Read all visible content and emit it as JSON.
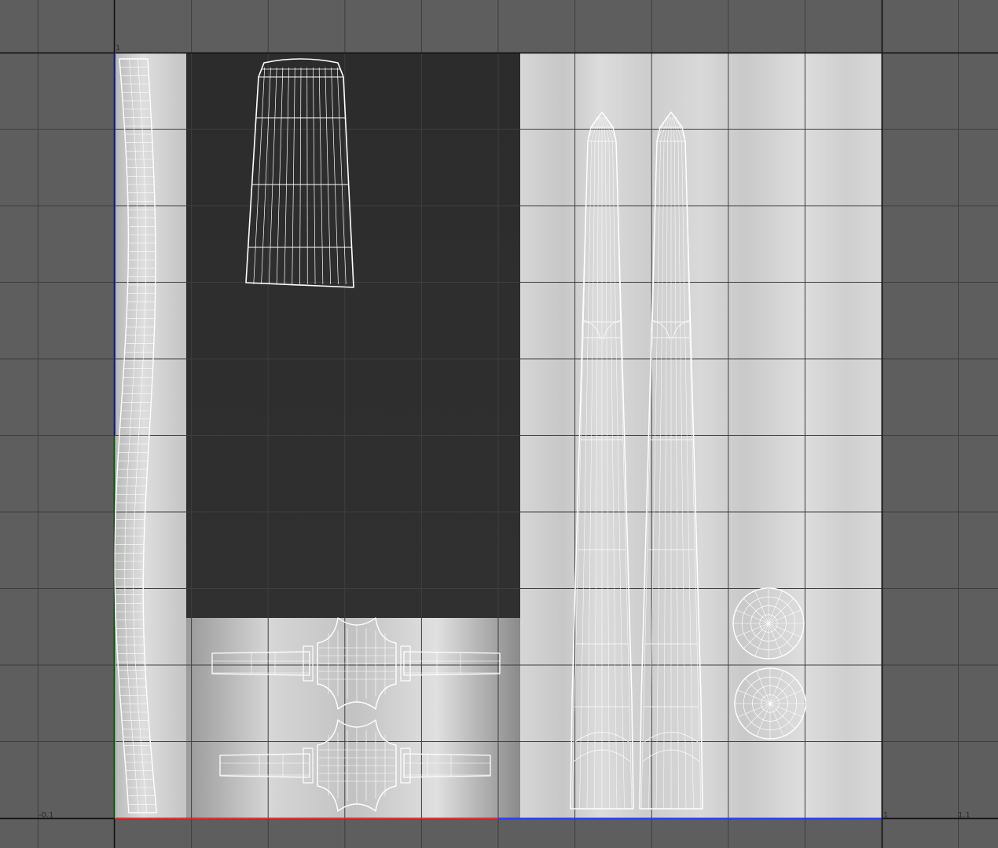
{
  "editor": {
    "axis_labels": {
      "u_min": "-0.1",
      "v_top": "1",
      "u_one": "1",
      "u_max": "1.1"
    }
  },
  "colors": {
    "background": "#5e5e5e",
    "grid_line": "#3c3c3c",
    "uv_boundary": "#111111",
    "wireframe": "#ffffff",
    "u_axis": "#e03030",
    "v_axis": "#40d040",
    "border_blue": "#2a3cff",
    "dark_panel": "#2e2e2e"
  },
  "uv_shells": [
    {
      "id": "cord",
      "icon": "uv-shell-cord"
    },
    {
      "id": "sleeve",
      "icon": "uv-shell-tapered-sleeve"
    },
    {
      "id": "spool-upper",
      "icon": "uv-shell-spool"
    },
    {
      "id": "spool-lower",
      "icon": "uv-shell-spool"
    },
    {
      "id": "blade-left",
      "icon": "uv-shell-blade"
    },
    {
      "id": "blade-right",
      "icon": "uv-shell-blade"
    },
    {
      "id": "disc-upper",
      "icon": "uv-shell-disc"
    },
    {
      "id": "disc-lower",
      "icon": "uv-shell-disc"
    }
  ]
}
